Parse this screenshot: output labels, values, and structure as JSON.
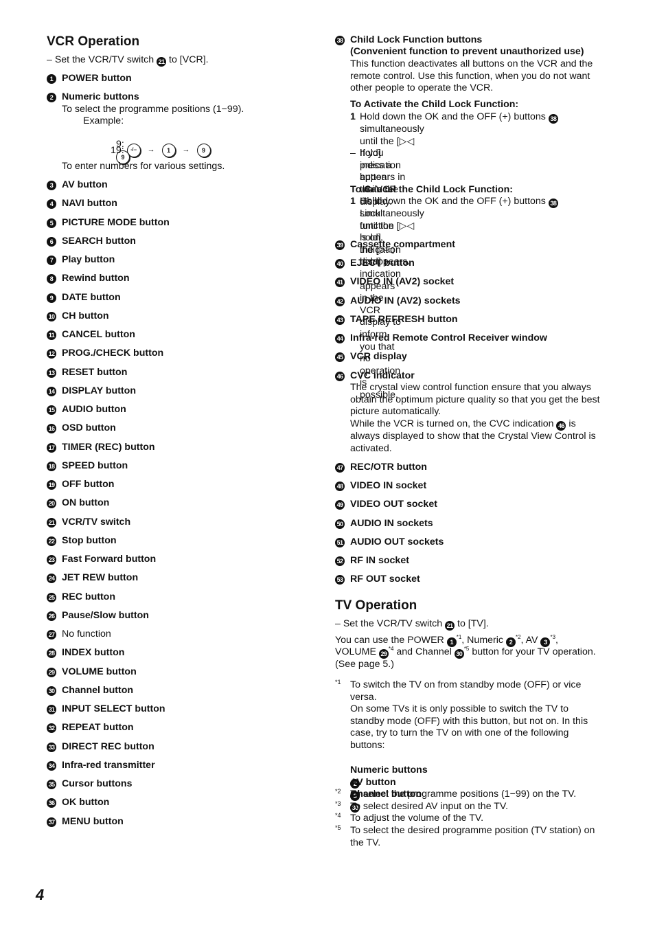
{
  "page_number": "4",
  "vcr": {
    "title": "VCR Operation",
    "switch_note": {
      "prefix": "– Set the VCR/TV switch",
      "ref": "21",
      "suffix": "to [VCR]."
    },
    "items": [
      {
        "n": "1",
        "label": "POWER button"
      },
      {
        "n": "2",
        "label": "Numeric buttons"
      },
      {
        "n": "3",
        "label": "AV button"
      },
      {
        "n": "4",
        "label": "NAVI button"
      },
      {
        "n": "5",
        "label": "PICTURE MODE button"
      },
      {
        "n": "6",
        "label": "SEARCH button"
      },
      {
        "n": "7",
        "label": "Play button"
      },
      {
        "n": "8",
        "label": "Rewind button"
      },
      {
        "n": "9",
        "label": "DATE button"
      },
      {
        "n": "10",
        "label": "CH button"
      },
      {
        "n": "11",
        "label": "CANCEL button"
      },
      {
        "n": "12",
        "label": "PROG./CHECK button"
      },
      {
        "n": "13",
        "label": "RESET button"
      },
      {
        "n": "14",
        "label": "DISPLAY button"
      },
      {
        "n": "15",
        "label": "AUDIO button"
      },
      {
        "n": "16",
        "label": "OSD button"
      },
      {
        "n": "17",
        "label": "TIMER (REC) button"
      },
      {
        "n": "18",
        "label": "SPEED button"
      },
      {
        "n": "19",
        "label": "OFF button"
      },
      {
        "n": "20",
        "label": "ON button"
      },
      {
        "n": "21",
        "label": "VCR/TV switch"
      },
      {
        "n": "22",
        "label": "Stop button"
      },
      {
        "n": "23",
        "label": "Fast Forward button"
      },
      {
        "n": "24",
        "label": "JET REW button"
      },
      {
        "n": "25",
        "label": "REC button"
      },
      {
        "n": "26",
        "label": "Pause/Slow button"
      },
      {
        "n": "27",
        "label": "No function"
      },
      {
        "n": "28",
        "label": "INDEX button"
      },
      {
        "n": "29",
        "label": "VOLUME button"
      },
      {
        "n": "30",
        "label": "Channel button"
      },
      {
        "n": "31",
        "label": "INPUT SELECT button"
      },
      {
        "n": "32",
        "label": "REPEAT button"
      },
      {
        "n": "33",
        "label": "DIRECT REC button"
      },
      {
        "n": "34",
        "label": "Infra-red transmitter"
      },
      {
        "n": "35",
        "label": "Cursor buttons"
      },
      {
        "n": "36",
        "label": "OK button"
      },
      {
        "n": "37",
        "label": "MENU button"
      }
    ],
    "numeric": {
      "line1": "To select the programme positions (1−99).",
      "example_label": "Example:",
      "ex1_label": "9:",
      "ex1_keys": [
        "9"
      ],
      "ex2_label": "19:",
      "ex2_keys": [
        "-/--",
        "1",
        "9"
      ],
      "arrow": "→",
      "line2": "To enter numbers for various settings."
    },
    "right_items": [
      {
        "n": "38",
        "label": "Child Lock Function buttons"
      },
      {
        "n": "39",
        "label": "Cassette compartment"
      },
      {
        "n": "40",
        "label": "EJECT button"
      },
      {
        "n": "41",
        "label": "VIDEO IN (AV2)  socket"
      },
      {
        "n": "42",
        "label": "AUDIO IN (AV2) sockets"
      },
      {
        "n": "43",
        "label": "TAPE REFRESH button"
      },
      {
        "n": "44",
        "label": "Infra-red Remote Control Receiver window"
      },
      {
        "n": "45",
        "label": "VCR display"
      },
      {
        "n": "46",
        "label": "CVC indicator"
      },
      {
        "n": "47",
        "label": "REC/OTR button"
      },
      {
        "n": "48",
        "label": "VIDEO IN socket"
      },
      {
        "n": "49",
        "label": "VIDEO OUT socket"
      },
      {
        "n": "50",
        "label": "AUDIO IN sockets"
      },
      {
        "n": "51",
        "label": "AUDIO OUT sockets"
      },
      {
        "n": "52",
        "label": "RF IN socket"
      },
      {
        "n": "53",
        "label": "RF OUT socket"
      }
    ],
    "child_lock": {
      "subtitle": "(Convenient function to prevent unauthorized use)",
      "desc": "This function deactivates all buttons on the VCR and the\nremote control. Use this function, when you do not want\nother people to operate the VCR.",
      "activate_title": "To Activate the Child Lock Function:",
      "activate_step_num": "1",
      "activate_step_a": "Hold down the OK and the OFF (+) buttons",
      "activate_step_ref": "38",
      "activate_step_b": "simultaneously until the [▷◁ hold] indication appears in\nthe VCR display.",
      "dash_mark": "–",
      "dash_text": "If you press a button while the Child Lock function is on,\nthe [▷◁ hold] indication appears in the VCR display to\ninform you that no operation is possible.",
      "cancel_title": "To Cancel the Child Lock Function:",
      "cancel_step_num": "1",
      "cancel_step_a": "Hold down the OK and the OFF (+) buttons",
      "cancel_step_ref": "38",
      "cancel_step_b": "simultaneously until the [▷◁ hold] indication\ndisappears."
    },
    "cvc": {
      "desc": "The crystal view control function ensure that you always\nobtain the optimum picture quality so that you get the best\npicture automatically.",
      "line_a": "While the VCR is turned on, the CVC indication",
      "ref": "46",
      "line_b": "is",
      "line_c": "always displayed to show that the Crystal View Control is\nactivated."
    }
  },
  "tv": {
    "title": "TV Operation",
    "switch_note": {
      "prefix": "– Set the VCR/TV switch",
      "ref": "21",
      "suffix": "to [TV]."
    },
    "usage": {
      "t1": "You can use the POWER",
      "r1": "1",
      "s1": "*1",
      "t2": ", Numeric",
      "r2": "2",
      "s2": "*2",
      "t3": ", AV",
      "r3": "3",
      "s3": "*3",
      "t4": ",",
      "t5": "VOLUME",
      "r5": "29",
      "s5": "*4",
      "t6": "and Channel",
      "r6": "30",
      "s6": "*5",
      "t7": "button for your TV operation.",
      "t8": "(See page 5.)"
    },
    "footnotes": [
      {
        "mark": "*1",
        "text": "To switch the TV on from standby mode (OFF) or vice\nversa.\nOn some TVs it is only possible to switch the TV to\nstandby mode (OFF) with this button, but not on. In this\ncase, try to turn the TV on with one of the following\nbuttons:"
      },
      {
        "mark": "*2",
        "text": "To select the programme positions (1−99) on the TV."
      },
      {
        "mark": "*3",
        "text": "To select desired AV input on the TV."
      },
      {
        "mark": "*4",
        "text": "To adjust the volume of the TV."
      },
      {
        "mark": "*5",
        "text": "To select the desired programme position (TV station) on\nthe TV."
      }
    ],
    "alt_buttons": [
      {
        "label": "Numeric buttons",
        "ref": "2"
      },
      {
        "label": "AV button",
        "ref": "3"
      },
      {
        "label": "Channel button",
        "ref": "30"
      }
    ]
  }
}
